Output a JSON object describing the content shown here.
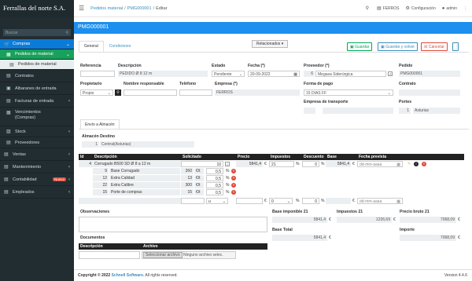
{
  "brand": "Ferrallas del norte S.A.",
  "sidebar": {
    "search_placeholder": "Buscar",
    "items": [
      {
        "label": "Compras"
      },
      {
        "label": "Pedidos de material"
      },
      {
        "label": "Pedidos de material"
      },
      {
        "label": "Contratos"
      },
      {
        "label": "Albaranes de entrada"
      },
      {
        "label": "Facturas de entrada"
      },
      {
        "label": "Vencimientos (Compras)"
      },
      {
        "label": "Stock"
      },
      {
        "label": "Proveedores"
      },
      {
        "label": "Ventas"
      },
      {
        "label": "Mantenimiento"
      },
      {
        "label": "Contabilidad",
        "badge": "Nuevo"
      },
      {
        "label": "Empleados"
      }
    ]
  },
  "topbar": {
    "crumbs": [
      "Pedidos material",
      "PMG000001",
      "Editar"
    ],
    "user_company": "FERROS",
    "settings_label": "Configuración",
    "user": "admin"
  },
  "title": "PMG000001",
  "tabs": [
    "General",
    "Condiciones"
  ],
  "toolbar": {
    "related": "Relacionados",
    "save": "Guardar",
    "save_back": "Guardar y volver",
    "cancel": "Cancelar"
  },
  "form": {
    "referencia_label": "Referencia",
    "descripcion_label": "Descripción",
    "descripcion": "PEDIDO Ø 8 12 m",
    "estado_label": "Estado",
    "estado": "Pendiente",
    "fecha_label": "Fecha (*)",
    "fecha": "20-09-2022",
    "proveedor_label": "Proveedor (*)",
    "proveedor_id": "6",
    "proveedor": "Megasa Siderúrgica",
    "pedido_label": "Pedido",
    "pedido": "PMG000001",
    "propietario_label": "Propietario",
    "propietario": "Propio",
    "nombre_resp_label": "Nombre responsable",
    "telefono_label": "Teléfono",
    "empresa_label": "Empresa (*)",
    "empresa": "FERROS",
    "forma_pago_label": "Forma de pago",
    "forma_pago": "15 DIAS FF",
    "contrato_label": "Contrato",
    "empresa_transporte_label": "Empresa de transporte",
    "portes_label": "Portes",
    "portes_id": "1",
    "portes": "Asturias"
  },
  "subtab": "Envío a Almacén",
  "almacen": {
    "label": "Almacén Destino",
    "id": "1",
    "value": "Central(Asturias)"
  },
  "lines": {
    "headers": [
      "Id",
      "Descripción",
      "Solicitado",
      "Precio",
      "Impuestos",
      "Descuento",
      "Base",
      "Fecha prevista"
    ],
    "main": {
      "id": "4",
      "descripcion": "Corrugado B500 SD Ø 8 a 12 m",
      "solicitado": "10",
      "precio": "5841,4",
      "impuesto": "21",
      "descuento": "0",
      "base": "5841,4",
      "fecha_placeholder": "dd-mm-aaaa"
    },
    "extras": [
      {
        "id": "9",
        "label": "Base Corrugado",
        "value": "260",
        "unit": "€/t",
        "pct": "0,5"
      },
      {
        "id": "12",
        "label": "Extra Calidad",
        "value": "13",
        "unit": "€/t",
        "pct": "0,5"
      },
      {
        "id": "22",
        "label": "Extra Calibre",
        "value": "300",
        "unit": "€/t",
        "pct": "0,5"
      },
      {
        "id": "15",
        "label": "Porte de compras",
        "value": "15",
        "unit": "€/t",
        "pct": "0,5"
      }
    ],
    "new_row": {
      "unit": "u",
      "impuesto": "0",
      "descuento": "0"
    }
  },
  "observaciones_label": "Observaciones",
  "totals": {
    "base_imponible_label": "Base imponible 21",
    "base_imponible": "5841,4",
    "impuestos_label": "Impuestos 21",
    "impuestos": "1226,69",
    "precio_bruto_label": "Precio bruto 21",
    "precio_bruto": "7068,09",
    "base_total_label": "Base Total",
    "base_total": "5841,4",
    "importe_label": "Importe",
    "importe": "7068,09",
    "currency": "€"
  },
  "documentos": {
    "label": "Documentos",
    "col_desc": "Descripción",
    "col_file": "Archivo",
    "btn": "Seleccionar archivo",
    "none": "Ninguno archivo selec."
  },
  "footer": {
    "prefix": "Copyright © 2022",
    "company": "Schnell Software.",
    "rights": "All rights reserved.",
    "version": "Version 4.4.6"
  }
}
